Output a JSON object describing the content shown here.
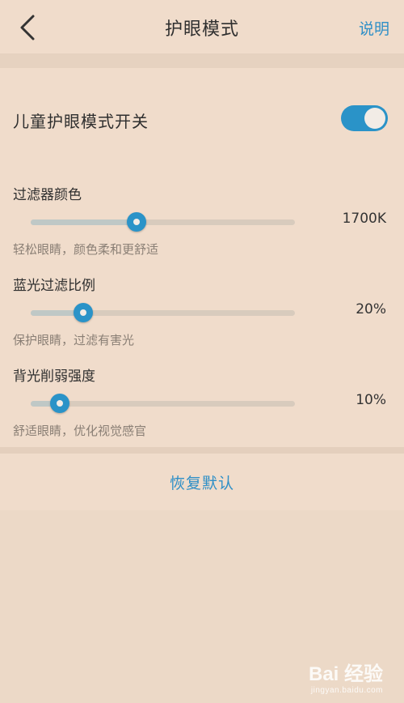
{
  "header": {
    "title": "护眼模式",
    "help_label": "说明",
    "back_icon": "chevron-left-icon"
  },
  "switch": {
    "label": "儿童护眼模式开关",
    "on": true,
    "color": "#2a93c8"
  },
  "settings": [
    {
      "label": "过滤器颜色",
      "value_text": "1700K",
      "level": 0.4,
      "description": "轻松眼睛，颜色柔和更舒适"
    },
    {
      "label": "蓝光过滤比例",
      "value_text": "20%",
      "level": 0.2,
      "description": "保护眼睛，过滤有害光"
    },
    {
      "label": "背光削弱强度",
      "value_text": "10%",
      "level": 0.11,
      "description": "舒适眼睛，优化视觉感官"
    }
  ],
  "reset_label": "恢复默认",
  "watermark": {
    "brand": "Bai 经验",
    "url": "jingyan.baidu.com"
  },
  "colors": {
    "accent": "#2a93c8",
    "background": "#ecd9c7",
    "card": "#f0dccb"
  }
}
